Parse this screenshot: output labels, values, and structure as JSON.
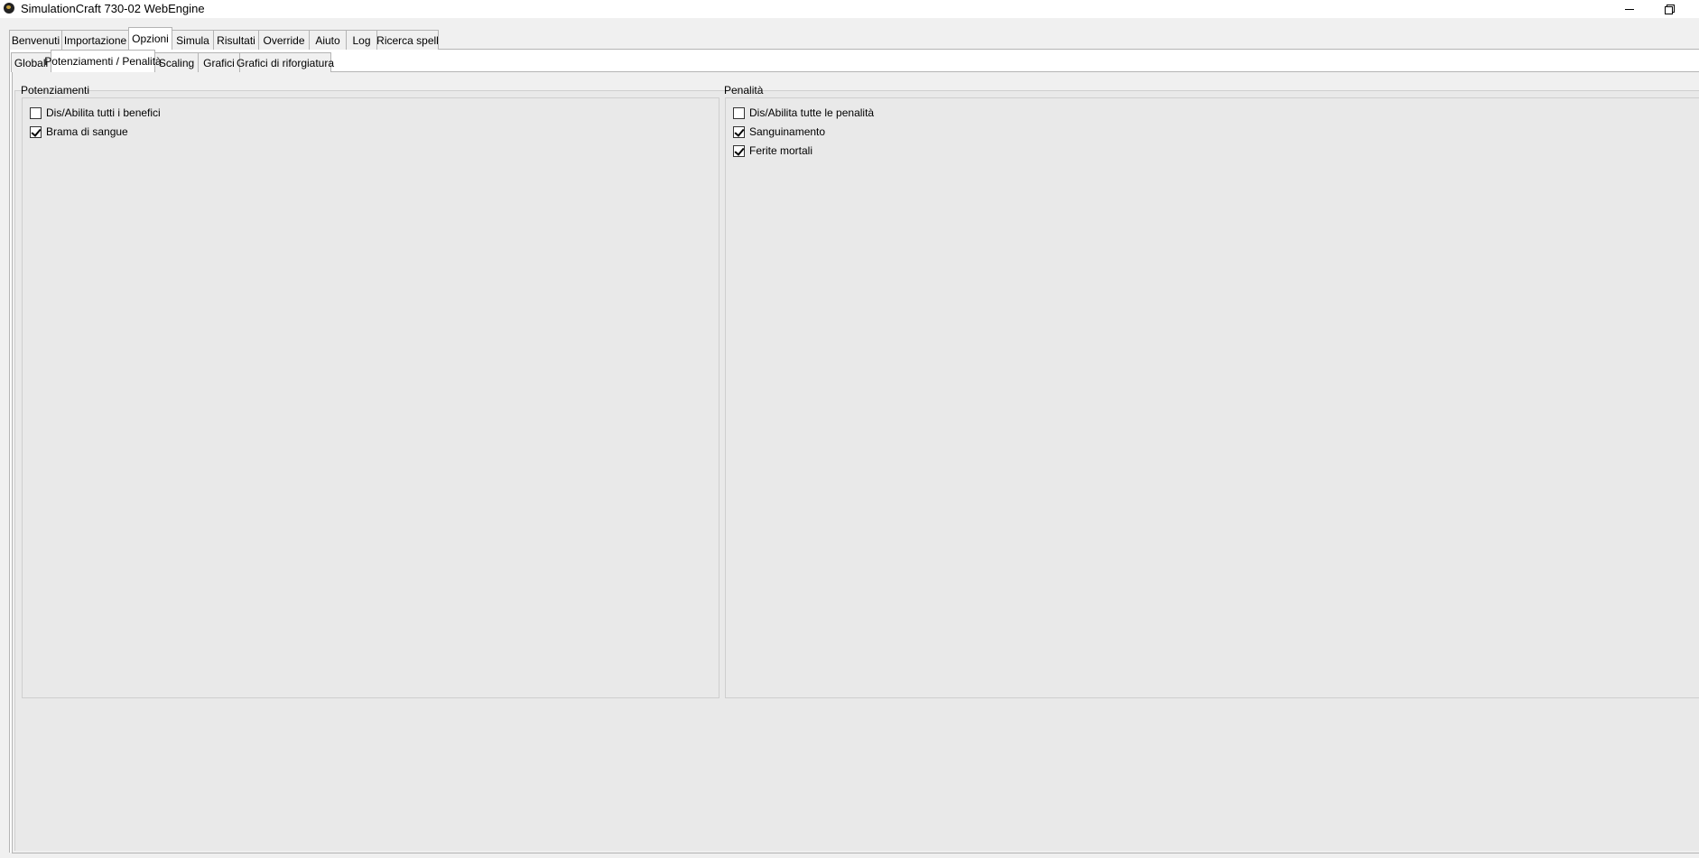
{
  "window": {
    "title": "SimulationCraft 730-02 WebEngine",
    "minimize_icon": "minimize-icon",
    "restore_icon": "restore-icon"
  },
  "main_tabs": [
    {
      "label": "Benvenuti",
      "active": false
    },
    {
      "label": "Importazione",
      "active": false
    },
    {
      "label": "Opzioni",
      "active": true
    },
    {
      "label": "Simula",
      "active": false
    },
    {
      "label": "Risultati",
      "active": false
    },
    {
      "label": "Override",
      "active": false
    },
    {
      "label": "Aiuto",
      "active": false
    },
    {
      "label": "Log",
      "active": false
    },
    {
      "label": "Ricerca spell",
      "active": false
    }
  ],
  "sub_tabs": [
    {
      "label": "Globali",
      "active": false
    },
    {
      "label": "Potenziamenti / Penalità",
      "active": true
    },
    {
      "label": "Scaling",
      "active": false
    },
    {
      "label": "Grafici",
      "active": false
    },
    {
      "label": "Grafici di riforgiatura",
      "active": false
    }
  ],
  "buffs": {
    "title": "Potenziamenti",
    "items": [
      {
        "label": "Dis/Abilita tutti i benefici",
        "checked": false
      },
      {
        "label": "Brama di sangue",
        "checked": true
      }
    ]
  },
  "debuffs": {
    "title": "Penalità",
    "items": [
      {
        "label": "Dis/Abilita tutte le penalità",
        "checked": false
      },
      {
        "label": "Sanguinamento",
        "checked": true
      },
      {
        "label": "Ferite mortali",
        "checked": true
      }
    ]
  }
}
